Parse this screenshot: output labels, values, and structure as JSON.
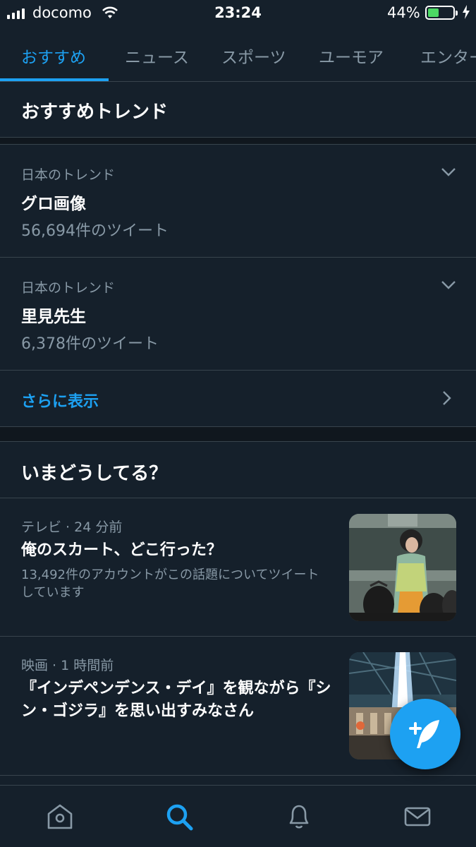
{
  "status_bar": {
    "carrier": "docomo",
    "time": "23:24",
    "battery_percent": "44%",
    "battery_level": 0.44
  },
  "tabs": [
    {
      "label": "おすすめ",
      "active": true
    },
    {
      "label": "ニュース",
      "active": false
    },
    {
      "label": "スポーツ",
      "active": false
    },
    {
      "label": "ユーモア",
      "active": false
    },
    {
      "label": "エンター",
      "active": false
    }
  ],
  "trends_section": {
    "title": "おすすめトレンド",
    "items": [
      {
        "context": "日本のトレンド",
        "name": "グロ画像",
        "count": "56,694件のツイート"
      },
      {
        "context": "日本のトレンド",
        "name": "里見先生",
        "count": "6,378件のツイート"
      }
    ],
    "show_more": "さらに表示"
  },
  "moments_section": {
    "title": "いまどうしてる？",
    "items": [
      {
        "meta": "テレビ · 24 分前",
        "headline": "俺のスカート、どこ行った？",
        "description": "13,492件のアカウントがこの話題についてツイートしています"
      },
      {
        "meta": "映画 · 1 時間前",
        "headline": "『インデペンデンス・デイ』を観ながら『シン・ゴジラ』を思い出すみなさん",
        "description": ""
      }
    ]
  },
  "bottom_nav": [
    {
      "icon": "home-icon",
      "active": false
    },
    {
      "icon": "search-icon",
      "active": true
    },
    {
      "icon": "notifications-icon",
      "active": false
    },
    {
      "icon": "messages-icon",
      "active": false
    }
  ],
  "colors": {
    "background": "#15202b",
    "accent": "#1da1f2",
    "secondary_text": "#8899a6",
    "divider": "#38444d"
  }
}
